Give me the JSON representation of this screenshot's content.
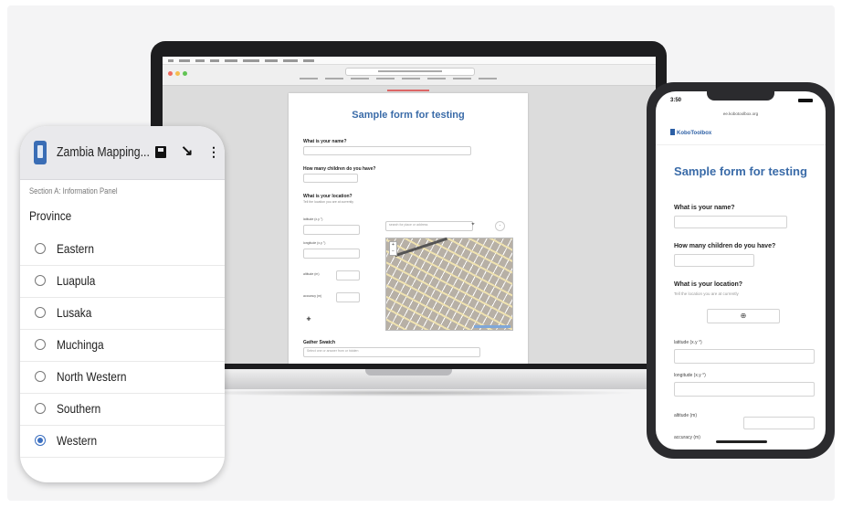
{
  "colors": {
    "accent": "#3a6ba8",
    "radio_selected": "#3b6fc0",
    "device_dark": "#1d1d1f"
  },
  "android": {
    "app_title": "Zambia Mapping...",
    "icons": [
      "app-icon",
      "save-icon",
      "sync-icon",
      "more-vert-icon"
    ],
    "group_label": "Section A: Information Panel",
    "question": "Province",
    "options": [
      {
        "label": "Eastern",
        "selected": false
      },
      {
        "label": "Luapula",
        "selected": false
      },
      {
        "label": "Lusaka",
        "selected": false
      },
      {
        "label": "Muchinga",
        "selected": false
      },
      {
        "label": "North Western",
        "selected": false
      },
      {
        "label": "Southern",
        "selected": false
      },
      {
        "label": "Western",
        "selected": true
      }
    ]
  },
  "laptop": {
    "form_title": "Sample form for testing",
    "q_name": "What is your name?",
    "q_children": "How many children do you have?",
    "q_location": "What is your location?",
    "location_hint": "Tell the location you are at currently",
    "latitude_label": "latitude (x.y °)",
    "longitude_label": "longitude (x.y °)",
    "altitude_label": "altitude (m)",
    "accuracy_label": "accuracy (m)",
    "search_placeholder": "search for place or address",
    "q_select": "Gather Swatch",
    "select_placeholder": "Select one or answer from or hidden"
  },
  "iphone": {
    "time": "3:50",
    "url": "ee.kobotoolbox.org",
    "brand": "KoboToolbox",
    "form_title": "Sample form for testing",
    "q_name": "What is your name?",
    "q_children": "How many children do you have?",
    "q_location": "What is your location?",
    "location_hint": "Tell the location you are at currently",
    "latitude_label": "latitude (x.y °)",
    "longitude_label": "longitude (x.y °)",
    "altitude_label": "altitude (m)",
    "accuracy_label": "accuracy (m)"
  }
}
